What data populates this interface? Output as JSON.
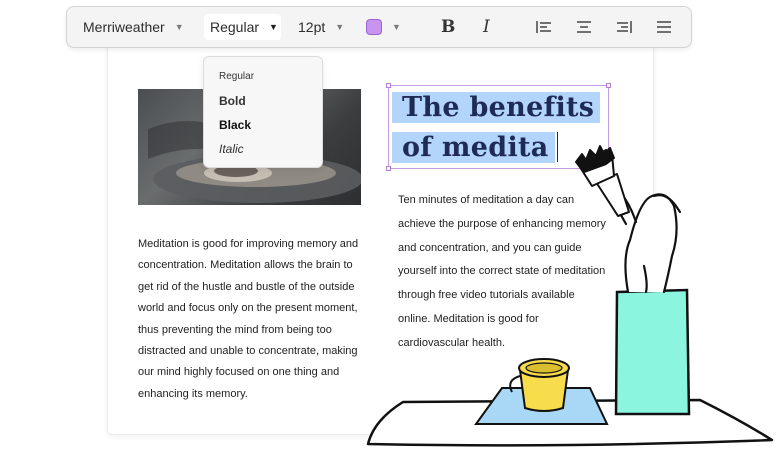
{
  "toolbar": {
    "font_family": "Merriweather",
    "font_style": "Regular",
    "font_size": "12pt",
    "text_color": "#c794f0",
    "bold_label": "B",
    "italic_label": "I"
  },
  "style_dropdown": {
    "items": [
      "Regular",
      "Bold",
      "Black",
      "Italic"
    ]
  },
  "document": {
    "headline_line1": "The benefits",
    "headline_line2": "of medita",
    "left_paragraph": "Meditation is good for improving memory and concentration. Meditation allows the brain to get rid of the hustle and bustle of the outside world and focus only on the present moment, thus preventing the mind from being too distracted and unable to concentrate, making our mind highly focused on one thing and enhancing its memory.",
    "right_paragraph": "Ten minutes of meditation a day can achieve the purpose of enhancing memory and concentration, and you can guide yourself into the correct state of meditation through free video tutorials available online. Meditation is good for cardiovascular health."
  },
  "colors": {
    "selection": "#b3d4fb",
    "headline": "#1d2b55",
    "box": "#8cf5e0",
    "bucket": "#f7dd4c",
    "mat": "#a8d8f5"
  }
}
